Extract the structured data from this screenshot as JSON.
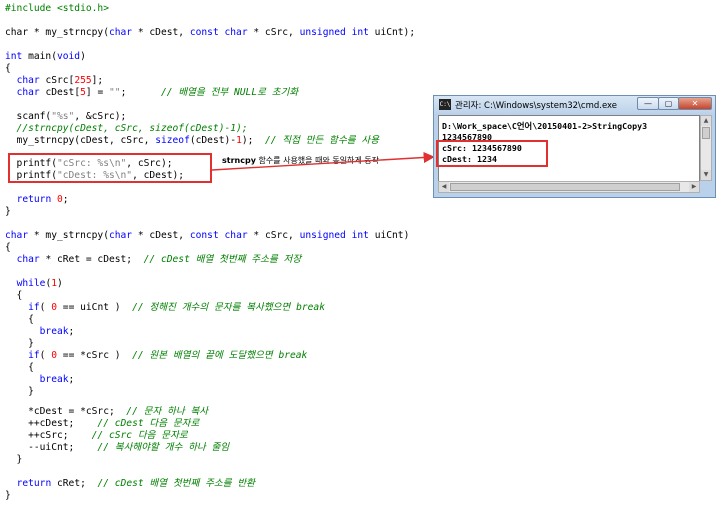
{
  "code": {
    "l1": {
      "a": "#include <stdio.h>"
    },
    "l2": {
      "a": "char * my_strncpy(",
      "b": "char",
      "c": " * cDest, ",
      "d": "const char",
      "e": " * cSrc, ",
      "f": "unsigned int",
      "g": " uiCnt);"
    },
    "l3": {
      "a": "int",
      "b": " main(",
      "c": "void",
      "d": ")"
    },
    "l4": {
      "a": "{"
    },
    "l5": {
      "a": "  ",
      "b": "char",
      "c": " cSrc[",
      "d": "255",
      "e": "];"
    },
    "l6": {
      "a": "  ",
      "b": "char",
      "c": " cDest[",
      "d": "5",
      "e": "] = ",
      "f": "\"\"",
      "g": ";",
      "h": "      // 배열을 전부 NULL로 초기화"
    },
    "l7": {
      "a": "  scanf(",
      "b": "\"%s\"",
      "c": ", &cSrc);"
    },
    "l8": {
      "a": "  //strncpy(cDest, cSrc, sizeof(cDest)-1);"
    },
    "l9": {
      "a": "  my_strncpy(cDest, cSrc, ",
      "b": "sizeof",
      "c": "(cDest)-",
      "d": "1",
      "e": ");  ",
      "f": "// 직접 만든 함수를 사용"
    },
    "l10": {
      "a": "  printf(",
      "b": "\"cSrc: %s\\n\"",
      "c": ", cSrc);"
    },
    "l11": {
      "a": "  printf(",
      "b": "\"cDest: %s\\n\"",
      "c": ", cDest);"
    },
    "l12": {
      "a": "  ",
      "b": "return",
      "c": " ",
      "d": "0",
      "e": ";"
    },
    "l13": {
      "a": "}"
    },
    "l14": {
      "a": "char",
      "b": " * my_strncpy(",
      "c": "char",
      "d": " * cDest, ",
      "e": "const char",
      "f": " * cSrc, ",
      "g": "unsigned int",
      "h": " uiCnt)"
    },
    "l15": {
      "a": "{"
    },
    "l16": {
      "a": "  ",
      "b": "char",
      "c": " * cRet = cDest;  ",
      "d": "// cDest 배열 첫번째 주소를 저장"
    },
    "l17": {
      "a": "  ",
      "b": "while",
      "c": "(",
      "d": "1",
      "e": ")"
    },
    "l18": {
      "a": "  {"
    },
    "l19": {
      "a": "    ",
      "b": "if",
      "c": "( ",
      "d": "0",
      "e": " == uiCnt )  ",
      "f": "// 정해진 개수의 문자를 복사했으면 break"
    },
    "l20": {
      "a": "    {"
    },
    "l21": {
      "a": "      ",
      "b": "break",
      "c": ";"
    },
    "l22": {
      "a": "    }"
    },
    "l23": {
      "a": "    ",
      "b": "if",
      "c": "( ",
      "d": "0",
      "e": " == *cSrc )  ",
      "f": "// 원본 배열의 끝에 도달했으면 break"
    },
    "l24": {
      "a": "    {"
    },
    "l25": {
      "a": "      ",
      "b": "break",
      "c": ";"
    },
    "l26": {
      "a": "    }"
    },
    "l27": {
      "a": "    *cDest = *cSrc;  ",
      "b": "// 문자 하나 복사"
    },
    "l28": {
      "a": "    ++cDest;    ",
      "b": "// cDest 다음 문자로"
    },
    "l29": {
      "a": "    ++cSrc;    ",
      "b": "// cSrc 다음 문자로"
    },
    "l30": {
      "a": "    --uiCnt;    ",
      "b": "// 복사해야할 개수 하나 줄임"
    },
    "l31": {
      "a": "  }"
    },
    "l32": {
      "a": "  ",
      "b": "return",
      "c": " cRet;  ",
      "d": "// cDest 배열 첫번째 주소를 반환"
    },
    "l33": {
      "a": "}"
    }
  },
  "annotation": {
    "bold": "strncpy",
    "rest": " 함수를 사용했을 때와 동일하게 동작"
  },
  "console": {
    "title": "관리자: C:\\Windows\\system32\\cmd.exe",
    "icon_text": "C:\\",
    "buttons": {
      "minimize": "—",
      "maximize": "▢",
      "close": "✕"
    },
    "lines": [
      "D:\\Work_space\\C언어\\20150401-2>StringCopy3",
      "1234567890",
      "cSrc: 1234567890",
      "cDest: 1234"
    ]
  },
  "colors": {
    "keyword": "#0000ff",
    "comment": "#008000",
    "string": "#808080",
    "number": "#800000",
    "highlight": "#e03030"
  }
}
